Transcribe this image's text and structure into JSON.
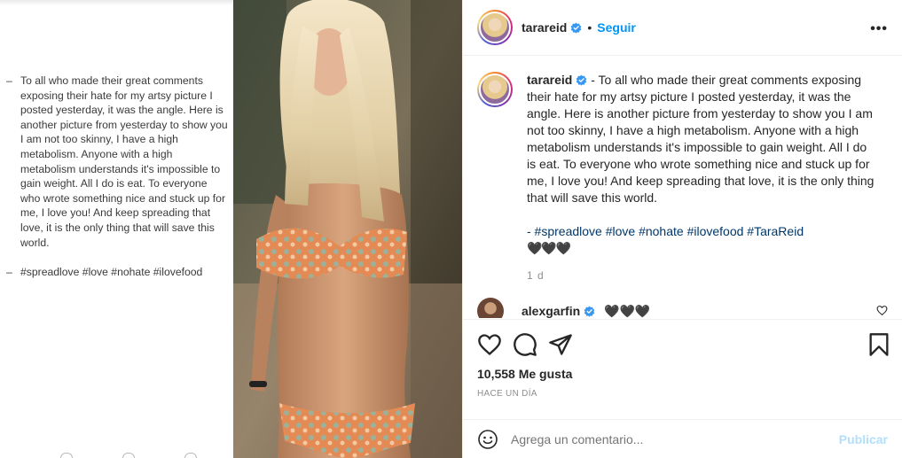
{
  "left_slide": {
    "lines": [
      "To all who made their great comments exposing their hate for my artsy picture I posted yesterday, it was the angle. Here is another picture from yesterday to show you I am not too skinny, I have a high metabolism. Anyone with a high metabolism understands it's impossible to gain weight. All I do is eat. To everyone who wrote something nice and stuck up for me, I love you! And keep spreading that love, it is the only thing that will save this world."
    ],
    "tags": "#spreadlove #love #nohate #ilovefood",
    "dash": "–"
  },
  "header": {
    "username": "tarareid",
    "separator": "•",
    "follow_label": "Seguir",
    "more_label": "•••"
  },
  "caption": {
    "username": "tarareid",
    "text": " - To all who made their great comments exposing their hate for my artsy picture I posted yesterday, it was the angle. Here is another picture from yesterday to show you I am not too skinny, I have a high metabolism. Anyone with a high metabolism understands it's impossible to gain weight. All I do is eat. To everyone who wrote something nice and stuck up for me, I love you! And keep spreading that love, it is the only thing that will save this world.",
    "tags": "- #spreadlove #love #nohate #ilovefood #TaraReid",
    "hearts": "🖤🖤🖤",
    "time": "1 d"
  },
  "comment": {
    "username": "alexgarfin",
    "text": "🖤🖤🖤"
  },
  "actions": {
    "likes": "10,558 Me gusta",
    "ago": "HACE UN DÍA"
  },
  "add_comment": {
    "placeholder": "Agrega un comentario...",
    "publish_label": "Publicar"
  },
  "colors": {
    "accent": "#0095f6",
    "verified": "#3897f0",
    "text": "#262626",
    "muted": "#8e8e8e"
  }
}
